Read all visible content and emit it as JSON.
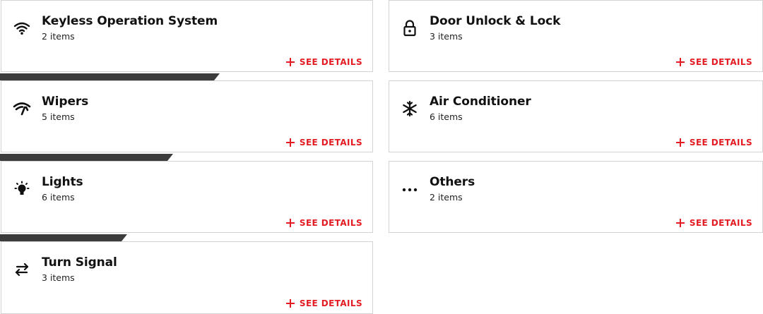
{
  "colors": {
    "accent": "#e31b23",
    "progress": "#3c3c3c",
    "border": "#d3d3d3"
  },
  "cards": [
    {
      "id": "keyless",
      "icon": "wifi-icon",
      "title": "Keyless Operation System",
      "count": "2 items",
      "details": "SEE DETAILS"
    },
    {
      "id": "door",
      "icon": "padlock-icon",
      "title": "Door Unlock & Lock",
      "count": "3 items",
      "details": "SEE DETAILS"
    },
    {
      "id": "wipers",
      "icon": "wiper-icon",
      "title": "Wipers",
      "count": "5 items",
      "details": "SEE DETAILS"
    },
    {
      "id": "aircon",
      "icon": "snowflake-icon",
      "title": "Air Conditioner",
      "count": "6 items",
      "details": "SEE DETAILS"
    },
    {
      "id": "lights",
      "icon": "lightbulb-icon",
      "title": "Lights",
      "count": "6 items",
      "details": "SEE DETAILS"
    },
    {
      "id": "others",
      "icon": "more-dots-icon",
      "title": "Others",
      "count": "2 items",
      "details": "SEE DETAILS"
    },
    {
      "id": "turn",
      "icon": "swap-arrows-icon",
      "title": "Turn Signal",
      "count": "3 items",
      "details": "SEE DETAILS"
    }
  ],
  "progress_bars": [
    {
      "after": "keyless",
      "fraction": 0.575
    },
    {
      "after": "wipers",
      "fraction": 0.452
    },
    {
      "after": "lights",
      "fraction": 0.333
    }
  ]
}
